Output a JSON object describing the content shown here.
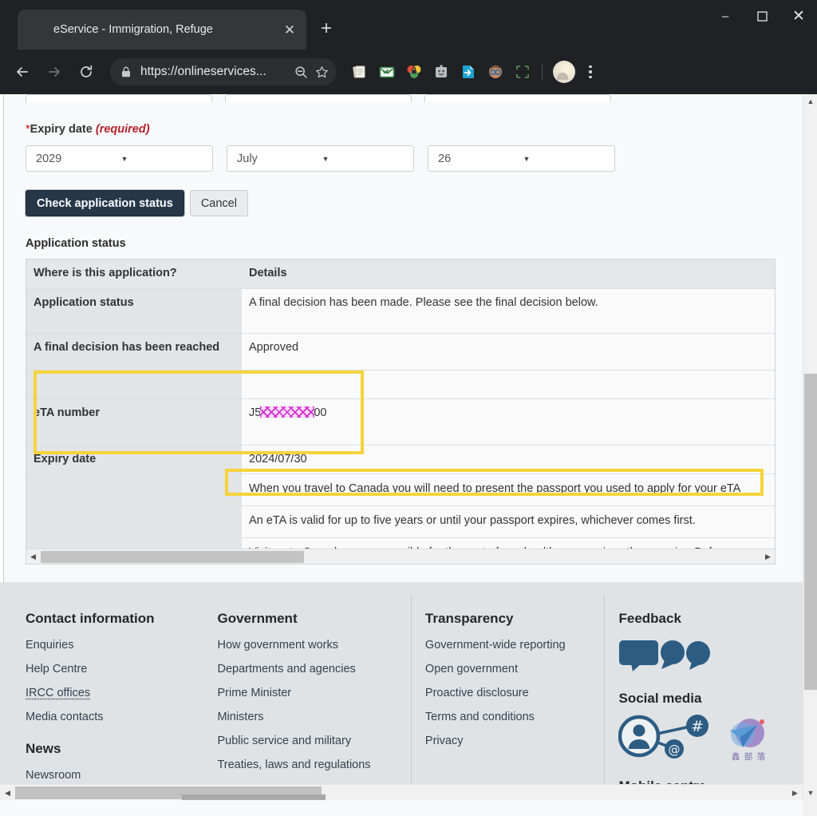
{
  "browser": {
    "tab": {
      "title": "eService - Immigration, Refuge",
      "favicon": "maple-leaf-icon",
      "close": "✕"
    },
    "new_tab_label": "+",
    "window_controls": {
      "minimize": "–",
      "maximize": "❐",
      "close": "✕"
    },
    "nav": {
      "back": "←",
      "forward": "→",
      "reload": "⟳"
    },
    "omnibox": {
      "url": "https://onlineservices...",
      "lock": "lock-icon",
      "zoom_out": "zoom-out-icon",
      "bookmark": "☆"
    },
    "menu": "kebab-menu-icon"
  },
  "form": {
    "expiry_label": "Expiry date",
    "required_star": "*",
    "required_note": "(required)",
    "year": "2029",
    "month": "July",
    "day": "26",
    "caret": "▼",
    "submit_label": "Check application status",
    "cancel_label": "Cancel"
  },
  "status": {
    "section_title": "Application status",
    "columns": [
      "Where is this application?",
      "Details"
    ],
    "rows": [
      {
        "label": "Application status",
        "value": "A final decision has been made. Please see the final decision below."
      },
      {
        "label": "A final decision has been reached",
        "value": "Approved"
      },
      {
        "label": "",
        "value": ""
      },
      {
        "label": "eTA number",
        "value_prefix": "J5",
        "value_redacted": "redacted-characters",
        "value_suffix": "00"
      },
      {
        "label": "Expiry date",
        "value": "2024/07/30"
      }
    ],
    "notes": [
      "When you travel to Canada you will need to present the passport you used to apply for your eTA",
      "An eTA is valid for up to five years or until your passport expires, whichever comes first.",
      "Visitors to Canada are responsible for the cost of any healthcare services they require. Before"
    ],
    "annotation_color": "#f5d33c",
    "scroll": {
      "left_arrow": "◀",
      "right_arrow": "▶"
    }
  },
  "footer": {
    "columns": [
      {
        "heading": "Contact information",
        "links": [
          "Enquiries",
          "Help Centre",
          "IRCC offices",
          "Media contacts"
        ],
        "heading2": "News",
        "links2": [
          "Newsroom"
        ]
      },
      {
        "heading": "Government",
        "links": [
          "How government works",
          "Departments and agencies",
          "Prime Minister",
          "Ministers",
          "Public service and military",
          "Treaties, laws and regulations"
        ]
      },
      {
        "heading": "Transparency",
        "links": [
          "Government-wide reporting",
          "Open government",
          "Proactive disclosure",
          "Terms and conditions",
          "Privacy"
        ]
      }
    ],
    "feedback": {
      "heading": "Feedback",
      "icon": "speech-bubbles-icon",
      "social_heading": "Social media",
      "social_icon": "social-network-icon",
      "mobile_heading": "Mobile centre",
      "watermark_text": "鑫 部 落"
    }
  },
  "scrollbars": {
    "vertical": {
      "up": "▲",
      "down": "▼"
    },
    "horizontal": {
      "left": "◀",
      "right": "▶"
    }
  }
}
